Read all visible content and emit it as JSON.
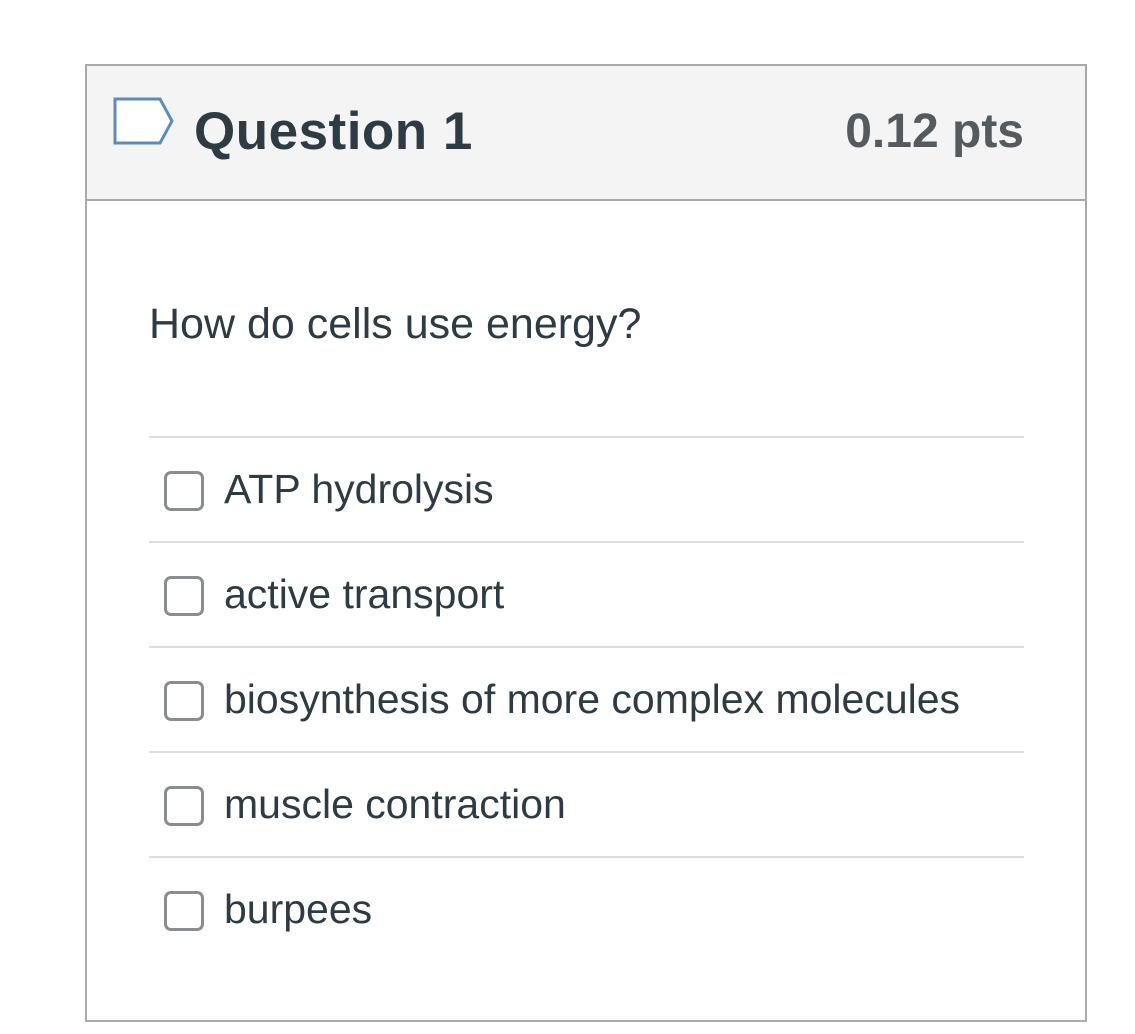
{
  "question": {
    "title": "Question 1",
    "points": "0.12 pts",
    "text": "How do cells use energy?",
    "flag_icon": "flag-outline-icon",
    "answers": [
      {
        "label": "ATP hydrolysis",
        "checked": false
      },
      {
        "label": "active transport",
        "checked": false
      },
      {
        "label": "biosynthesis of more complex molecules",
        "checked": false
      },
      {
        "label": "muscle contraction",
        "checked": false
      },
      {
        "label": "burpees",
        "checked": false
      }
    ]
  },
  "colors": {
    "header_background": "#f4f4f4",
    "border": "#aaaaaa",
    "text": "#2d3b45",
    "points_text": "#555a5f",
    "flag_stroke": "#5b8db8",
    "checkbox_border": "#8a8d8f",
    "divider": "#dddddd"
  }
}
